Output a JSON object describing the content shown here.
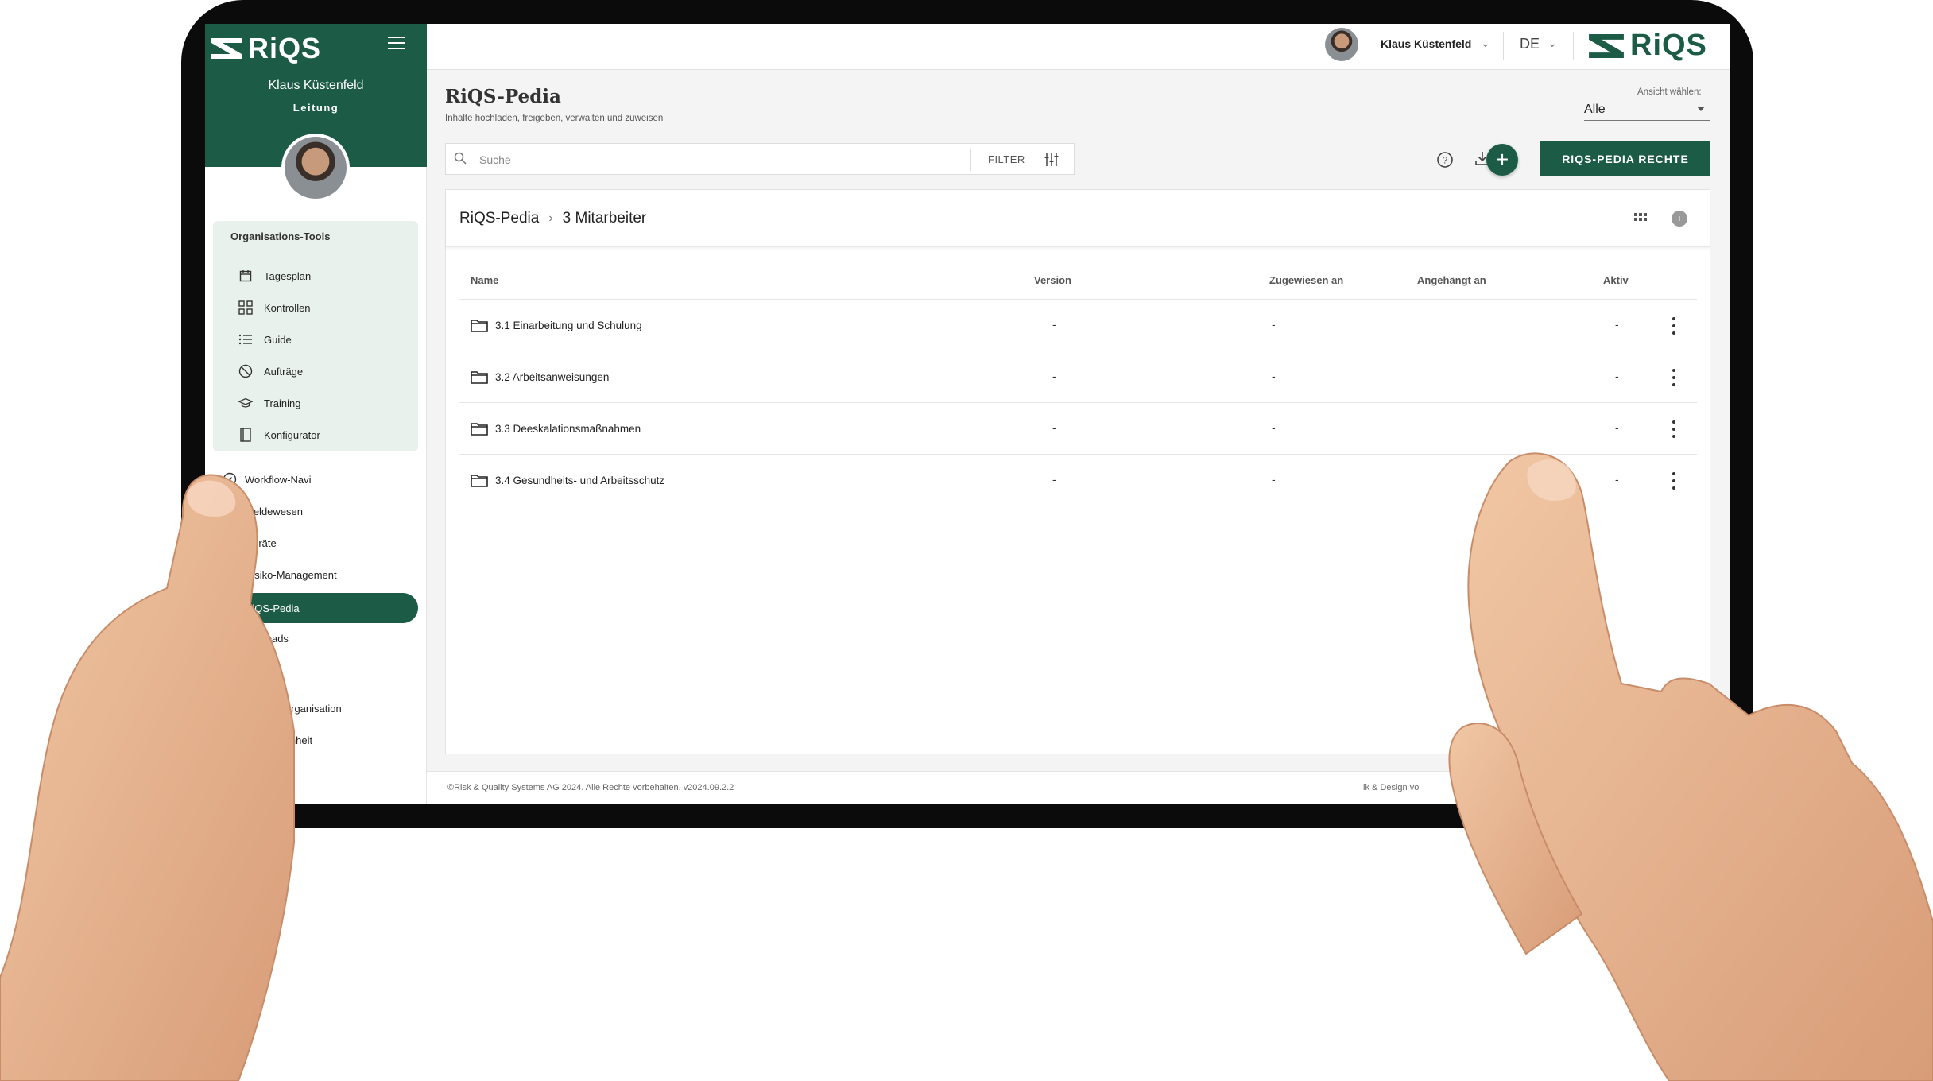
{
  "app": {
    "logo_text": "RiQS",
    "user_name": "Klaus Küstenfeld",
    "user_role": "Leitung",
    "language": "DE",
    "brand_color": "#1c5c47"
  },
  "sidebar": {
    "tools_title": "Organisations-Tools",
    "tools": [
      {
        "label": "Tagesplan",
        "icon": "calendar-icon"
      },
      {
        "label": "Kontrollen",
        "icon": "grid-icon"
      },
      {
        "label": "Guide",
        "icon": "list-icon"
      },
      {
        "label": "Aufträge",
        "icon": "no-entry-icon"
      },
      {
        "label": "Training",
        "icon": "graduation-cap-icon"
      },
      {
        "label": "Konfigurator",
        "icon": "document-icon"
      }
    ],
    "items": [
      {
        "label": "Workflow-Navi",
        "icon": "compass-icon"
      },
      {
        "label": "Meldewesen"
      },
      {
        "label": "Geräte"
      },
      {
        "label": "Risiko-Management"
      },
      {
        "label": "RiQS-Pedia",
        "active": true
      },
      {
        "label": "ownloads"
      },
      {
        "label": "Organisation"
      },
      {
        "label": "inheit"
      }
    ]
  },
  "header": {
    "title": "RiQS-Pedia",
    "subtitle": "Inhalte hochladen, freigeben, verwalten und zuweisen",
    "view_label": "Ansicht wählen:",
    "view_value": "Alle"
  },
  "toolbar": {
    "search_placeholder": "Suche",
    "filter_label": "FILTER",
    "rights_button": "RIQS-PEDIA RECHTE",
    "add_symbol": "+"
  },
  "breadcrumb": {
    "root": "RiQS-Pedia",
    "current": "3 Mitarbeiter",
    "info_count": "i"
  },
  "table": {
    "columns": [
      "Name",
      "Version",
      "Zugewiesen an",
      "Angehängt an",
      "Aktiv"
    ],
    "rows": [
      {
        "name": "3.1 Einarbeitung und Schulung",
        "version": "-",
        "assigned": "-",
        "attached": "",
        "active": "-"
      },
      {
        "name": "3.2 Arbeitsanweisungen",
        "version": "-",
        "assigned": "-",
        "attached": "",
        "active": "-"
      },
      {
        "name": "3.3 Deeskalationsmaßnahmen",
        "version": "-",
        "assigned": "-",
        "attached": "",
        "active": "-"
      },
      {
        "name": "3.4 Gesundheits- und Arbeitsschutz",
        "version": "-",
        "assigned": "-",
        "attached": "",
        "active": "-"
      }
    ]
  },
  "footer": {
    "copyright": "©Risk & Quality Systems AG 2024. Alle Rechte vorbehalten. v2024.09.2.2",
    "right_text": "ik & Design vo"
  }
}
